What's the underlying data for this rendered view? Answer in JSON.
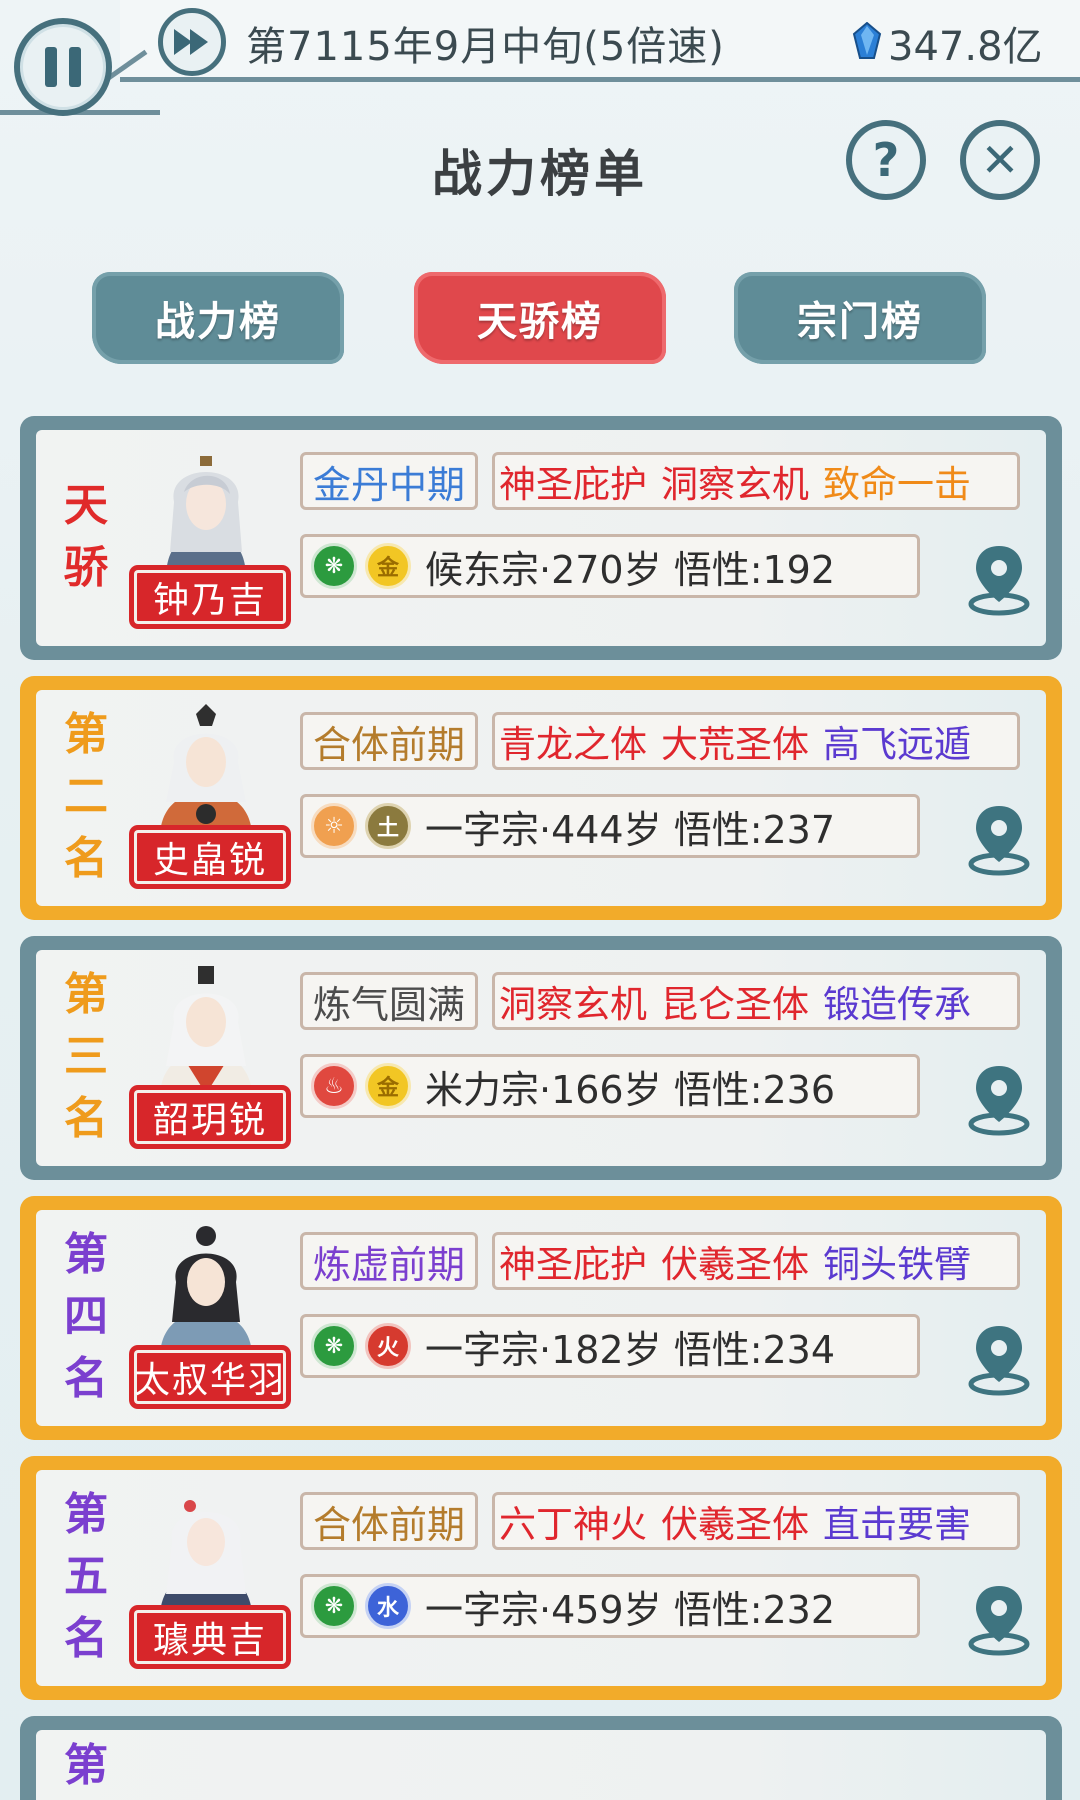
{
  "status_bar": {
    "date": "第7115年9月中旬(5倍速)",
    "currency": "347.8亿"
  },
  "page": {
    "title": "战力榜单",
    "help_label": "?",
    "close_label": "✕"
  },
  "tabs": [
    {
      "label": "战力榜",
      "active": false
    },
    {
      "label": "天骄榜",
      "active": true
    },
    {
      "label": "宗门榜",
      "active": false
    }
  ],
  "entries": [
    {
      "rank": [
        "天",
        "骄"
      ],
      "name": "钟乃吉",
      "realm": "金丹中期",
      "traits": [
        "神圣庇护",
        "洞察玄机",
        "致命一击"
      ],
      "sect_icon": "leaf-emblem-icon",
      "element": "金",
      "info": "候东宗·270岁 悟性:192"
    },
    {
      "rank": [
        "第",
        "二",
        "名"
      ],
      "name": "史皛锐",
      "realm": "合体前期",
      "traits": [
        "青龙之体",
        "大荒圣体",
        "高飞远遁"
      ],
      "sect_icon": "sun-emblem-icon",
      "element": "土",
      "info": "一字宗·444岁 悟性:237"
    },
    {
      "rank": [
        "第",
        "三",
        "名"
      ],
      "name": "韶玥锐",
      "realm": "炼气圆满",
      "traits": [
        "洞察玄机",
        "昆仑圣体",
        "锻造传承"
      ],
      "sect_icon": "phoenix-emblem-icon",
      "element": "金",
      "info": "米力宗·166岁 悟性:236"
    },
    {
      "rank": [
        "第",
        "四",
        "名"
      ],
      "name": "太叔华羽",
      "realm": "炼虚前期",
      "traits": [
        "神圣庇护",
        "伏羲圣体",
        "铜头铁臂"
      ],
      "sect_icon": "leaf-emblem-icon",
      "element": "火",
      "info": "一字宗·182岁 悟性:234"
    },
    {
      "rank": [
        "第",
        "五",
        "名"
      ],
      "name": "璩典吉",
      "realm": "合体前期",
      "traits": [
        "六丁神火",
        "伏羲圣体",
        "直击要害"
      ],
      "sect_icon": "leaf-emblem-icon",
      "element": "水",
      "info": "一字宗·459岁 悟性:232"
    }
  ],
  "partial_entry": {
    "rank": "第"
  },
  "colors": {
    "gray_frame": "#6c8f9a",
    "gold_frame": "#f2ab2a",
    "name_tag": "#d7262a",
    "tab_active": "#e0484c",
    "tab_inactive": "#5f8c97"
  }
}
